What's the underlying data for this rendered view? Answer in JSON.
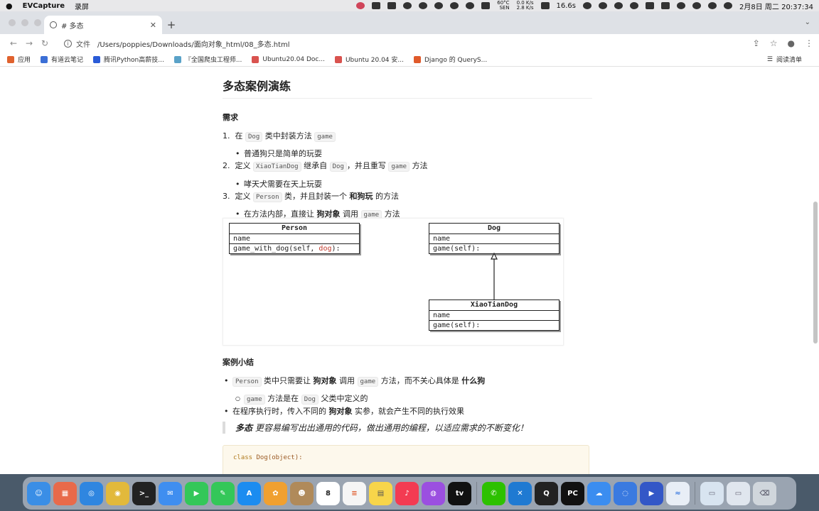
{
  "menubar": {
    "app_name": "EVCapture",
    "menu_item": "录屏",
    "temp": "60°C",
    "temp_label": "SEN",
    "net_up": "0.0 K/s",
    "net_down": "2.8 K/s",
    "timer": "16.6s",
    "datetime": "2月8日 周二  20:37:34"
  },
  "browser": {
    "tab_title": "# 多态",
    "new_tab": "+",
    "url_scheme": "文件",
    "url": "/Users/poppies/Downloads/面向对象_html/08_多态.html",
    "bookmarks": [
      {
        "label": "应用",
        "color": "#e0622e"
      },
      {
        "label": "有道云笔记",
        "color": "#3b6fd6"
      },
      {
        "label": "腾讯Python高薪技...",
        "color": "#2a5bd7"
      },
      {
        "label": "『全国爬虫工程师...",
        "color": "#5aa2c8"
      },
      {
        "label": "Ubuntu20.04 Doc...",
        "color": "#d9534f"
      },
      {
        "label": "Ubuntu 20.04 安...",
        "color": "#d9534f"
      },
      {
        "label": "Django 的 QueryS...",
        "color": "#e05a2b"
      }
    ],
    "reading_list": "阅读清单"
  },
  "article": {
    "title": "多态案例演练",
    "req_heading": "需求",
    "item1_num": "1.",
    "item1_a": "在",
    "item1_code1": "Dog",
    "item1_b": "类中封装方法",
    "item1_code2": "game",
    "item1_sub": "普通狗只是简单的玩耍",
    "item2_num": "2.",
    "item2_a": "定义",
    "item2_code1": "XiaoTianDog",
    "item2_b": "继承自",
    "item2_code2": "Dog",
    "item2_c": "，并且重写",
    "item2_code3": "game",
    "item2_d": "方法",
    "item2_sub": "哮天犬需要在天上玩耍",
    "item3_num": "3.",
    "item3_a": "定义",
    "item3_code1": "Person",
    "item3_b": "类，并且封装一个",
    "item3_bold": "和狗玩",
    "item3_c": "的方法",
    "item3_sub_a": "在方法内部，直接让",
    "item3_sub_bold": "狗对象",
    "item3_sub_b": "调用",
    "item3_sub_code": "game",
    "item3_sub_c": "方法",
    "summary_heading": "案例小结",
    "sum1_code1": "Person",
    "sum1_a": "类中只需要让",
    "sum1_bold1": "狗对象",
    "sum1_b": "调用",
    "sum1_code2": "game",
    "sum1_c": "方法，而不关心具体是",
    "sum1_bold2": "什么狗",
    "sum1_sub_code1": "game",
    "sum1_sub_a": "方法是在",
    "sum1_sub_code2": "Dog",
    "sum1_sub_b": "父类中定义的",
    "sum2_a": "在程序执行时，传入不同的",
    "sum2_bold": "狗对象",
    "sum2_b": "实参，就会产生不同的执行效果",
    "quote_bold": "多态",
    "quote_text": "更容易编写出出通用的代码，做出通用的编程，以适应需求的不断变化！",
    "code_kw": "class",
    "code_name": "Dog(object):"
  },
  "uml": {
    "person": {
      "name": "Person",
      "attr": "name",
      "method_a": "game_with_dog(self, ",
      "method_red": "dog",
      "method_b": "):"
    },
    "dog": {
      "name": "Dog",
      "attr": "name",
      "method": "game(self):"
    },
    "xtd": {
      "name": "XiaoTianDog",
      "attr": "name",
      "method": "game(self):"
    }
  },
  "dock": [
    {
      "name": "Finder",
      "color": "#3a8ee6",
      "glyph": "☺"
    },
    {
      "name": "Launchpad",
      "color": "#e86a4a",
      "glyph": "▦"
    },
    {
      "name": "Safari",
      "color": "#2f86e0",
      "glyph": "◎"
    },
    {
      "name": "Chrome",
      "color": "#e2b93b",
      "glyph": "◉"
    },
    {
      "name": "Terminal",
      "color": "#222222",
      "glyph": ">_"
    },
    {
      "name": "Mail",
      "color": "#3f8ef0",
      "glyph": "✉"
    },
    {
      "name": "FaceTime",
      "color": "#34c759",
      "glyph": "▶"
    },
    {
      "name": "Messages",
      "color": "#34c759",
      "glyph": "✎"
    },
    {
      "name": "App Store",
      "color": "#1b8cf0",
      "glyph": "A"
    },
    {
      "name": "Photos",
      "color": "#f0a030",
      "glyph": "✿"
    },
    {
      "name": "Contacts",
      "color": "#b08a5a",
      "glyph": "☻"
    },
    {
      "name": "Calendar",
      "color": "#ffffff",
      "glyph": "8"
    },
    {
      "name": "Reminders",
      "color": "#f5f5f5",
      "glyph": "≡"
    },
    {
      "name": "Notes",
      "color": "#f7d54a",
      "glyph": "▤"
    },
    {
      "name": "Music",
      "color": "#f33b52",
      "glyph": "♪"
    },
    {
      "name": "Podcasts",
      "color": "#9b4fe0",
      "glyph": "◍"
    },
    {
      "name": "TV",
      "color": "#111111",
      "glyph": "tv"
    },
    {
      "name": "WeChat",
      "color": "#2dc100",
      "glyph": "✆"
    },
    {
      "name": "VS Code",
      "color": "#1f7ad2",
      "glyph": "✕"
    },
    {
      "name": "QQ",
      "color": "#222222",
      "glyph": "Q"
    },
    {
      "name": "PyCharm",
      "color": "#111111",
      "glyph": "PC"
    },
    {
      "name": "Baidu Netdisk",
      "color": "#3b8df0",
      "glyph": "☁"
    },
    {
      "name": "Feishu",
      "color": "#3a7ae0",
      "glyph": "◌"
    },
    {
      "name": "Screen Recorder",
      "color": "#3357c7",
      "glyph": "▶"
    },
    {
      "name": "Tencent Meeting",
      "color": "#e8eef6",
      "glyph": "≈"
    },
    {
      "name": "Downloads",
      "color": "#d8e4f0",
      "glyph": "▭"
    },
    {
      "name": "Documents",
      "color": "#e0e6ee",
      "glyph": "▭"
    },
    {
      "name": "Trash",
      "color": "#d0d6dc",
      "glyph": "🗑"
    }
  ]
}
